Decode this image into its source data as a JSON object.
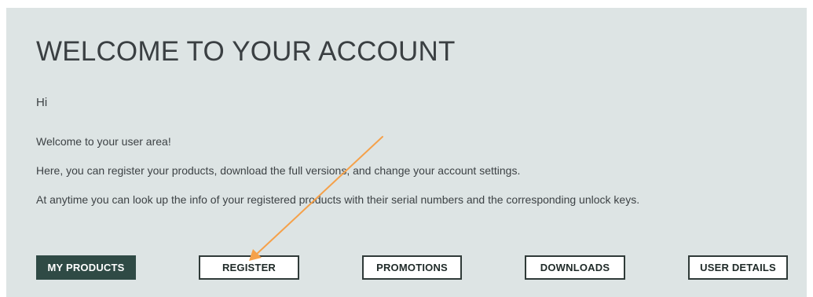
{
  "page": {
    "title": "WELCOME TO YOUR ACCOUNT",
    "greeting": "Hi",
    "paragraphs": [
      "Welcome to your user area!",
      "Here, you can register your products, download the full versions, and change your account settings.",
      "At anytime you can look up the info of your registered products with their serial numbers and the corresponding unlock keys."
    ]
  },
  "nav": {
    "buttons": [
      {
        "label": "MY PRODUCTS",
        "active": true
      },
      {
        "label": "REGISTER",
        "active": false
      },
      {
        "label": "PROMOTIONS",
        "active": false
      },
      {
        "label": "DOWNLOADS",
        "active": false
      },
      {
        "label": "USER DETAILS",
        "active": false
      }
    ]
  },
  "colors": {
    "panel_bg": "#dde4e4",
    "active_button_bg": "#2f4a45",
    "annotation_arrow": "#f5a14a"
  }
}
